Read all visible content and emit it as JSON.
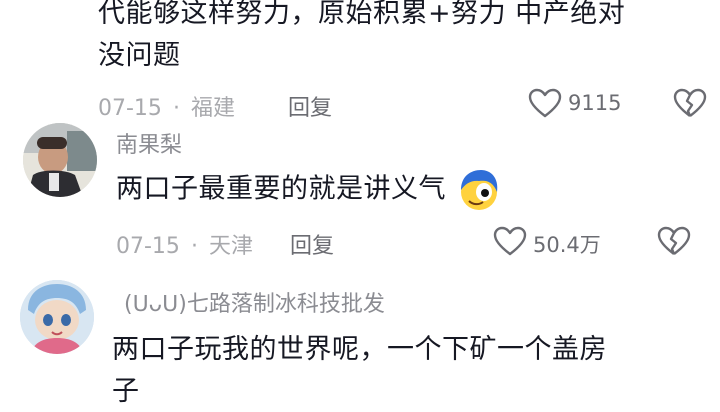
{
  "comments": [
    {
      "text_line1": "代能够这样努力，原始积累+努力 中产绝对",
      "text_line2": "没问题",
      "date": "07-15",
      "sep": "·",
      "location": "福建",
      "reply_label": "回复",
      "likes": "9115"
    },
    {
      "author": "南果梨",
      "text": "两口子最重要的就是讲义气",
      "date": "07-15",
      "sep": "·",
      "location": "天津",
      "reply_label": "回复",
      "likes": "50.4万"
    },
    {
      "author": "(ᑌᴗᑌ)七路落制冰科技批发",
      "text_line1": "两口子玩我的世界呢，一个下矿一个盖房",
      "text_line2": "子"
    }
  ],
  "colors": {
    "meta_gray": "#a8a9ad",
    "text_dark": "#161823",
    "emoji_blue": "#2f6ed8",
    "emoji_yellow": "#ffd23f"
  },
  "icons": [
    "heart-outline-icon",
    "broken-heart-icon",
    "emoji-sticker-icon"
  ]
}
